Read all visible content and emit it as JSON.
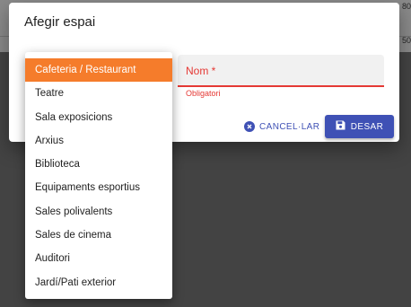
{
  "background": {
    "num1": "80",
    "num2": "50"
  },
  "dialog": {
    "title": "Afegir espai",
    "name_field": {
      "label": "Nom *",
      "helper": "Obligatori"
    },
    "cancel_label": "CANCEL·LAR",
    "save_label": "DESAR"
  },
  "menu": {
    "selected": "Cafeteria / Restaurant",
    "items": [
      "Cafeteria / Restaurant",
      "Teatre",
      "Sala exposicions",
      "Arxius",
      "Biblioteca",
      "Equipaments esportius",
      "Sales polivalents",
      "Sales de cinema",
      "Auditori",
      "Jardí/Pati exterior"
    ]
  },
  "colors": {
    "accent": "#3f51b5",
    "error": "#e53935",
    "selected": "#f57c2b"
  },
  "icons": {
    "cancel": "cancel-circle-icon",
    "save": "floppy-disk-icon"
  }
}
